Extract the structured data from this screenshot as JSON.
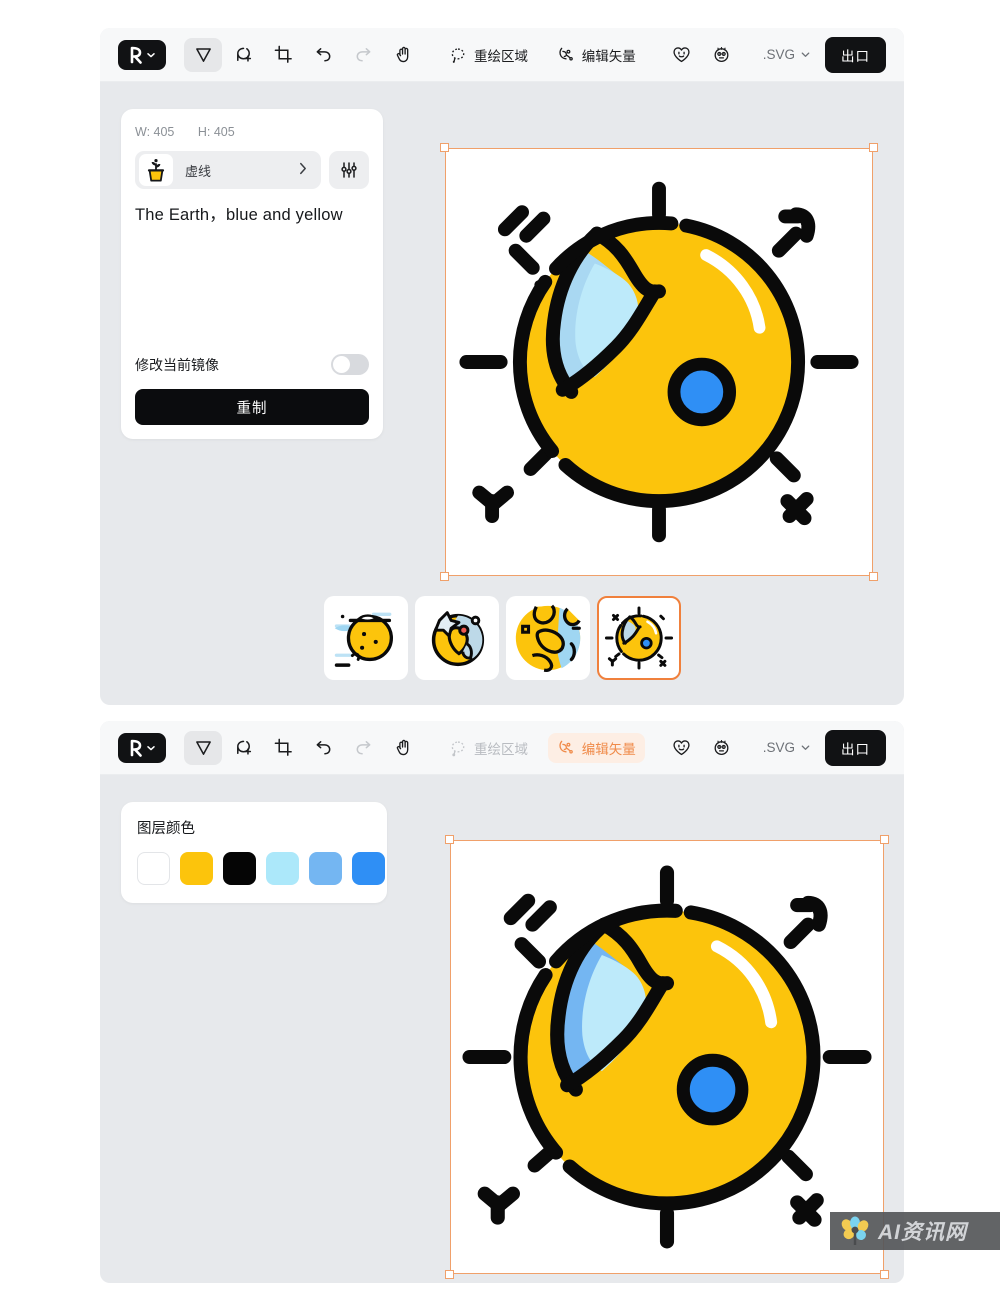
{
  "app": {
    "logo_icon": "brand-r-logo",
    "logo_caret": "chevron-down-icon"
  },
  "toolbar_top": {
    "tools": [
      {
        "name": "select-tool",
        "icon": "cursor-arrow-icon",
        "active": true
      },
      {
        "name": "add-selection-tool",
        "icon": "lasso-plus-icon",
        "active": false
      },
      {
        "name": "crop-tool",
        "icon": "crop-frame-icon",
        "active": false
      },
      {
        "name": "undo-tool",
        "icon": "undo-arrow-icon",
        "active": false
      },
      {
        "name": "redo-tool",
        "icon": "redo-arrow-icon",
        "active": false
      },
      {
        "name": "pan-tool",
        "icon": "hand-icon",
        "active": false
      }
    ],
    "repaint_label": "重绘区域",
    "repaint_icon": "dashed-lasso-icon",
    "edit_vector_label": "编辑矢量",
    "edit_vector_icon": "vector-pen-icon",
    "heart_face_icon": "heart-smiley-icon",
    "round_face_icon": "round-smiley-icon",
    "format_label": ".SVG",
    "format_caret": "chevron-down-icon",
    "export_label": "出口"
  },
  "toolbar_bottom": {
    "tools": [
      {
        "name": "select-tool",
        "icon": "cursor-arrow-icon",
        "active": true
      },
      {
        "name": "add-selection-tool",
        "icon": "lasso-plus-icon",
        "active": false
      },
      {
        "name": "crop-tool",
        "icon": "crop-frame-icon",
        "active": false
      },
      {
        "name": "undo-tool",
        "icon": "undo-arrow-icon",
        "active": false
      },
      {
        "name": "redo-tool",
        "icon": "redo-arrow-icon",
        "active": false
      },
      {
        "name": "pan-tool",
        "icon": "hand-icon",
        "active": false
      }
    ],
    "repaint_label": "重绘区域",
    "repaint_icon": "dashed-lasso-icon",
    "edit_vector_label": "编辑矢量",
    "edit_vector_icon": "vector-pen-icon",
    "heart_face_icon": "heart-smiley-icon",
    "round_face_icon": "round-smiley-icon",
    "format_label": ".SVG",
    "format_caret": "chevron-down-icon",
    "export_label": "出口"
  },
  "side_panel": {
    "width_label": "W: 405",
    "height_label": "H: 405",
    "style_icon": "potted-plant-icon",
    "style_name": "虚线",
    "style_chevron": "chevron-right-icon",
    "adjust_icon": "sliders-icon",
    "prompt_text": "The Earth，blue and yellow",
    "mirror_label": "修改当前镜像",
    "mirror_toggle_on": false,
    "regenerate_label": "重制"
  },
  "color_panel": {
    "title": "图层颜色",
    "swatches": [
      {
        "name": "swatch-white",
        "hex": "#FFFFFF"
      },
      {
        "name": "swatch-yellow",
        "hex": "#FCC40C"
      },
      {
        "name": "swatch-black",
        "hex": "#050505"
      },
      {
        "name": "swatch-light-cyan",
        "hex": "#ACE8FA"
      },
      {
        "name": "swatch-sky-blue",
        "hex": "#74B6F2"
      },
      {
        "name": "swatch-bright-blue",
        "hex": "#2F8FF5"
      }
    ]
  },
  "canvas_top": {
    "artwork_name": "earth-sun-yellow-blue-illustration",
    "selected": true
  },
  "canvas_bottom": {
    "artwork_name": "earth-sun-yellow-blue-illustration",
    "selected": true
  },
  "thumbnails": [
    {
      "name": "thumbnail-variant-1",
      "selected": false
    },
    {
      "name": "thumbnail-variant-2",
      "selected": false
    },
    {
      "name": "thumbnail-variant-3",
      "selected": false
    },
    {
      "name": "thumbnail-variant-4",
      "selected": true
    }
  ],
  "watermark": {
    "text": "AI资讯网",
    "logo_icon": "flower-logo-icon"
  },
  "colors": {
    "accent_orange": "#F0803C",
    "selection_orange": "#F0A06A",
    "panel_bg": "#E7E9EC",
    "toolbar_bg": "#F7F8F9",
    "yellow": "#FCC40C",
    "blue": "#2F8FF5"
  }
}
